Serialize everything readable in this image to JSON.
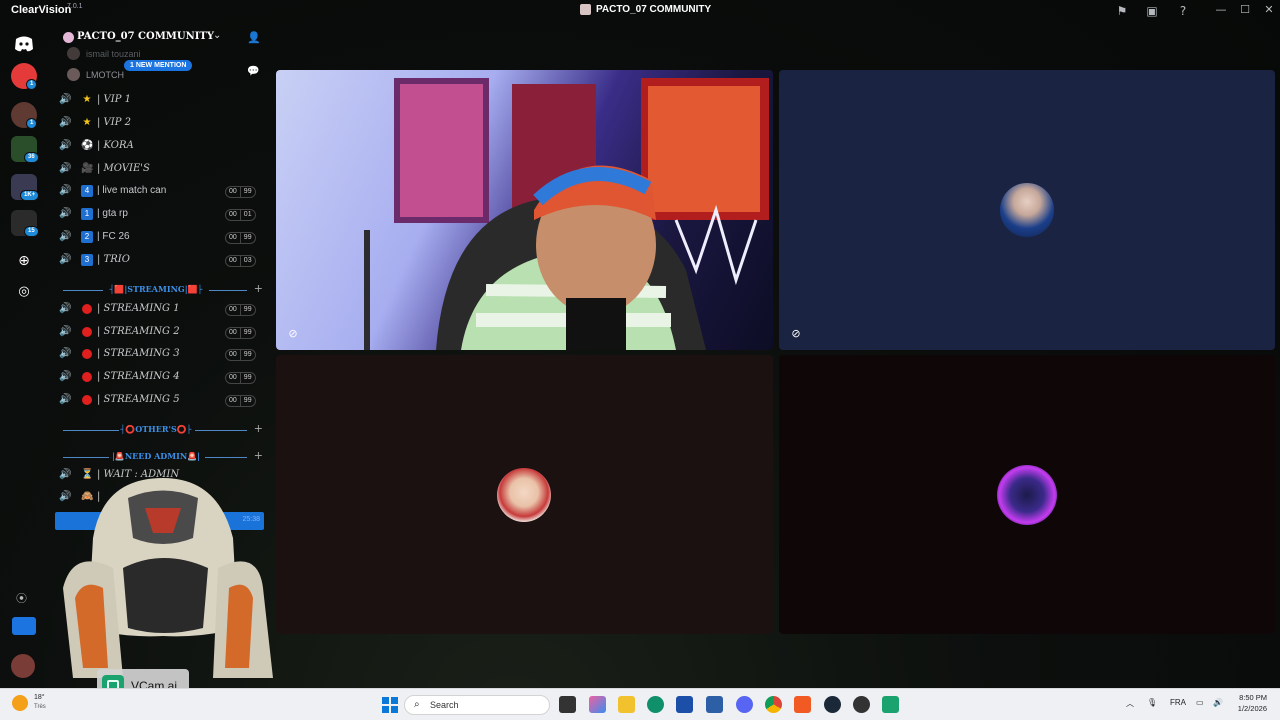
{
  "titlebar": {
    "app_name": "ClearVision",
    "app_version": "7.0.1",
    "window_title": "PACTO_07 COMMUNITY"
  },
  "rail": {
    "badges": [
      "1",
      "1",
      "36",
      "1K+",
      "15"
    ]
  },
  "sidebar": {
    "guild_name": "PACTO_07 COMMUNITY",
    "members": [
      {
        "name": "ismail touzani"
      },
      {
        "name": "LMOTCH"
      }
    ],
    "mention_pill": "1 NEW MENTION",
    "channels": [
      {
        "emoji": "★",
        "label": "| VIP 1"
      },
      {
        "emoji": "★",
        "label": "| VIP 2"
      },
      {
        "emoji": "⚽",
        "label": "| KORA"
      },
      {
        "emoji": "🎥",
        "label": "| MOVIE'S"
      },
      {
        "num": "4",
        "label": "| live match can",
        "counts": [
          "00",
          "99"
        ]
      },
      {
        "num": "1",
        "label": "| gta rp",
        "counts": [
          "00",
          "01"
        ]
      },
      {
        "num": "2",
        "label": "| FC 26",
        "counts": [
          "00",
          "99"
        ]
      },
      {
        "num": "3",
        "label": "| TRIO",
        "counts": [
          "00",
          "03"
        ]
      }
    ],
    "categories": {
      "streaming": "┤🟥|STREAMING|🟥├",
      "others": "┤⭕OTHER'S⭕├",
      "need_admin": "|🚨NEED ADMIN🚨|"
    },
    "streaming_channels": [
      {
        "label": "| STREAMING 1",
        "counts": [
          "00",
          "99"
        ]
      },
      {
        "label": "| STREAMING 2",
        "counts": [
          "00",
          "99"
        ]
      },
      {
        "label": "| STREAMING 3",
        "counts": [
          "00",
          "99"
        ]
      },
      {
        "label": "| STREAMING 4",
        "counts": [
          "00",
          "99"
        ]
      },
      {
        "label": "| STREAMING 5",
        "counts": [
          "00",
          "99"
        ]
      }
    ],
    "admin_channels": [
      {
        "emoji": "⏳",
        "label": "| WAIT : ADMIN"
      },
      {
        "emoji": "🙈",
        "label": "|"
      }
    ],
    "selected_time": "25:38"
  },
  "overlay": {
    "vcam_label": "VCam.ai"
  },
  "taskbar": {
    "search_placeholder": "Search",
    "weather": "18°",
    "weather_sub": "Très",
    "language": "FRA",
    "time": "8:50 PM",
    "date": "1/2/2026"
  },
  "colors": {
    "accent": "#1a73d8",
    "category_blue": "#3d8ee6",
    "stream_red": "#e01f1f",
    "tile_navy": "#1b2342",
    "tile_dark": "#1b1111"
  }
}
